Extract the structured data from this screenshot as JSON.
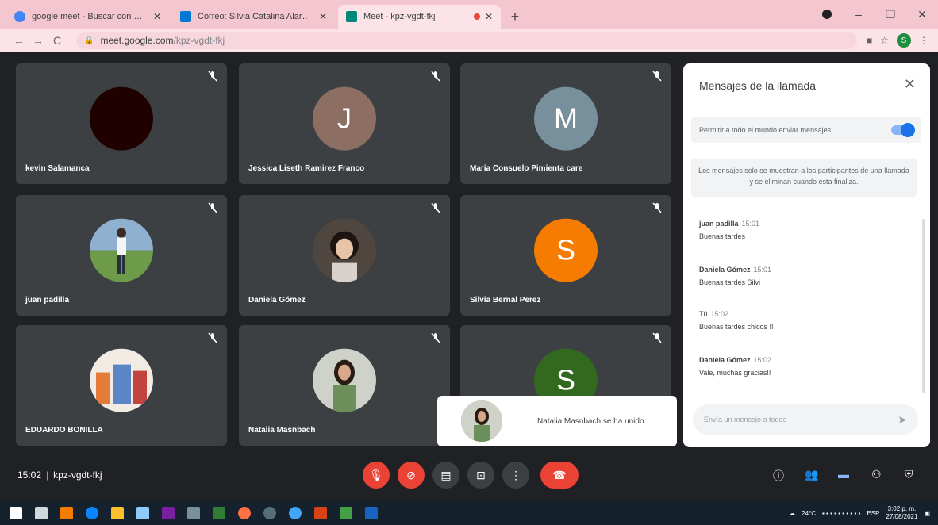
{
  "browser": {
    "tabs": [
      {
        "label": "google meet - Buscar con Goog",
        "color": "#4285f4",
        "active": false
      },
      {
        "label": "Correo: Silvia Catalina Alarcon G",
        "color": "#0078d4",
        "active": false
      },
      {
        "label": "Meet - kpz-vgdt-fkj",
        "color": "#00897b",
        "active": true
      }
    ],
    "new_tab_icon": "plus-icon",
    "url_host": "meet.google.com",
    "url_path": "/kpz-vgdt-fkj",
    "profile_initial": "S"
  },
  "tiles": [
    {
      "name": "kevin Salamanca",
      "initial": "",
      "bg": "#1f0100",
      "photo": false
    },
    {
      "name": "Jessica Liseth Ramirez Franco",
      "initial": "J",
      "bg": "#8d6e63",
      "photo": false
    },
    {
      "name": "Maria Consuelo Pimienta care",
      "initial": "M",
      "bg": "#78909c",
      "photo": false
    },
    {
      "name": "juan padilla",
      "initial": "",
      "bg": "#7b9bb5",
      "photo": true
    },
    {
      "name": "Daniela Gómez",
      "initial": "",
      "bg": "#4e463f",
      "photo": true
    },
    {
      "name": "Silvia Bernal Perez",
      "initial": "S",
      "bg": "#f57c00",
      "photo": false
    },
    {
      "name": "EDUARDO BONILLA",
      "initial": "",
      "bg": "#d8a07a",
      "photo": true
    },
    {
      "name": "Natalia Masnbach",
      "initial": "",
      "bg": "#6d8f5b",
      "photo": true
    },
    {
      "name": "",
      "initial": "S",
      "bg": "#33691e",
      "photo": false
    }
  ],
  "toast": {
    "text": "Natalia Masnbach se ha unido"
  },
  "chat": {
    "title": "Mensajes de la llamada",
    "allow_label": "Permitir a todo el mundo enviar mensajes",
    "info": "Los mensajes solo se muestran a los participantes de una llamada y se eliminan cuando esta finaliza.",
    "messages": [
      {
        "sender": "juan padilla",
        "time": "15:01",
        "text": "Buenas tardes"
      },
      {
        "sender": "Daniela Gómez",
        "time": "15:01",
        "text": "Buenas tardes Silvi"
      },
      {
        "sender": "Tú",
        "time": "15:02",
        "text": "Buenas tardes chicos !!"
      },
      {
        "sender": "Daniela Gómez",
        "time": "15:02",
        "text": "Vale, muchas gracias!!"
      }
    ],
    "compose_placeholder": "Envía un mensaje a todos"
  },
  "meetbar": {
    "time": "15:02",
    "code": "kpz-vgdt-fkj"
  },
  "taskbar": {
    "temp": "24°C",
    "lang": "ESP",
    "clock_time": "3:02 p. m.",
    "clock_date": "27/08/2021"
  },
  "colors": {
    "accent": "#1a73e8",
    "danger": "#ea4335",
    "surface": "#3c4043"
  }
}
